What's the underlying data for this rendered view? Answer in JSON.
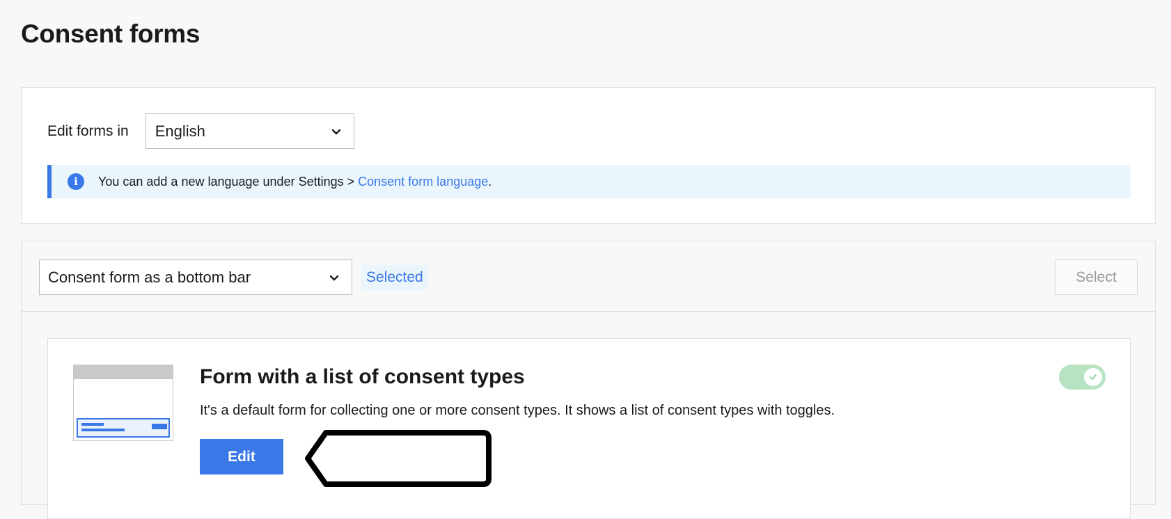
{
  "page": {
    "title": "Consent forms"
  },
  "language": {
    "label": "Edit forms in",
    "selected": "English",
    "info_text": "You can add a new language under Settings > ",
    "info_link": "Consent form language",
    "info_suffix": "."
  },
  "form_type": {
    "selected": "Consent form as a bottom bar",
    "badge": "Selected",
    "select_button": "Select"
  },
  "card": {
    "title": "Form with a list of consent types",
    "description": "It's a default form for collecting one or more consent types. It shows a list of consent types with toggles.",
    "edit_button": "Edit",
    "toggle_on": true
  },
  "icons": {
    "info": "info-icon",
    "chevron": "chevron-down-icon",
    "check": "check-icon"
  },
  "colors": {
    "accent": "#3a78e7",
    "info_bg": "#eaf5fc",
    "toggle_on": "#b8e3c3"
  }
}
